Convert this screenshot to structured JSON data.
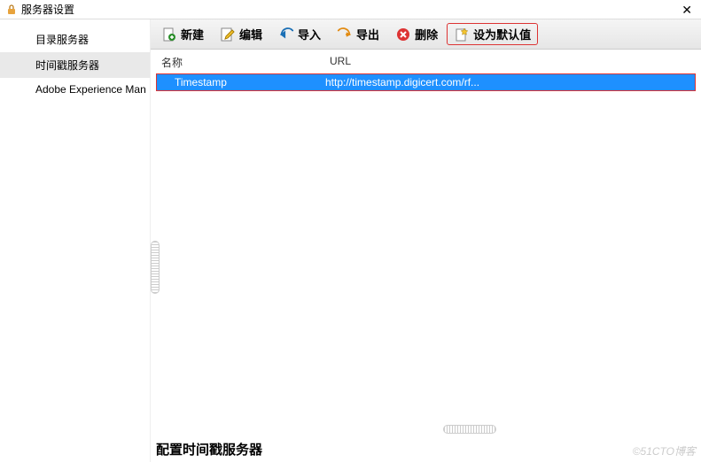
{
  "window": {
    "title": "服务器设置"
  },
  "sidebar": {
    "items": [
      {
        "label": "目录服务器"
      },
      {
        "label": "时间戳服务器"
      },
      {
        "label": "Adobe Experience Man"
      }
    ],
    "selected_index": 1
  },
  "toolbar": {
    "new_label": "新建",
    "edit_label": "编辑",
    "import_label": "导入",
    "export_label": "导出",
    "delete_label": "删除",
    "set_default_label": "设为默认值"
  },
  "columns": {
    "name": "名称",
    "url": "URL"
  },
  "rows": [
    {
      "name": "Timestamp",
      "url": "http://timestamp.digicert.com/rf..."
    }
  ],
  "detail": {
    "heading": "配置时间戳服务器"
  },
  "watermark": "©51CTO博客"
}
